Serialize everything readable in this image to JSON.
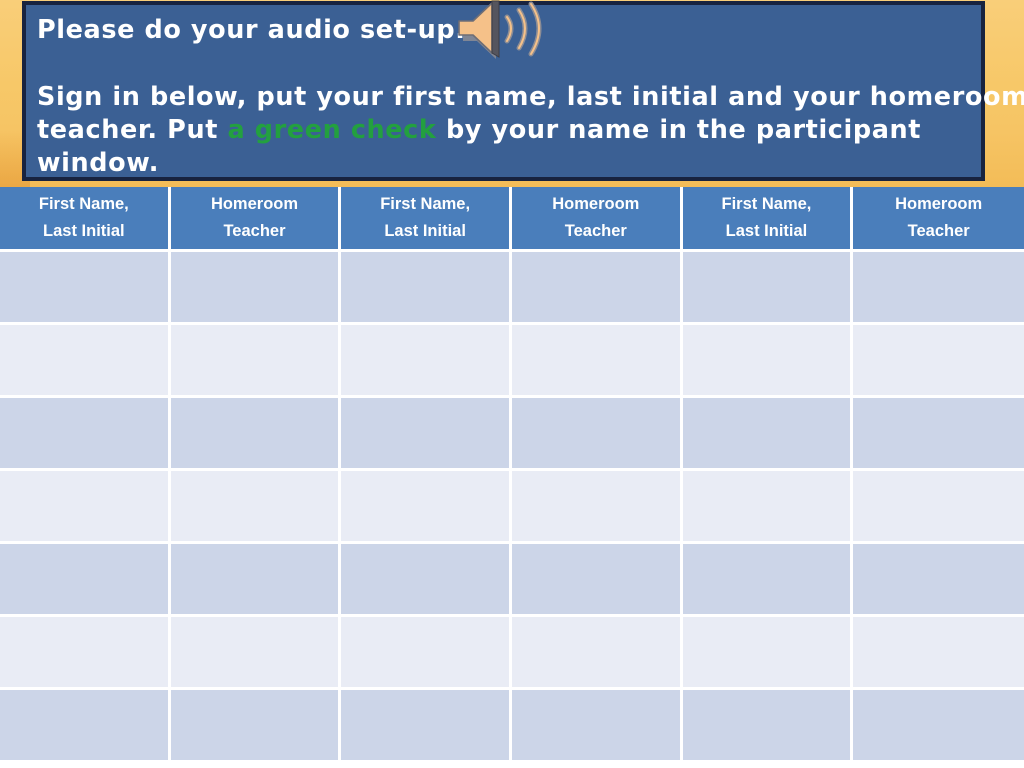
{
  "slide": {
    "accent_orange": "#f7c868",
    "callout_bg": "#3b6094",
    "callout_border": "#18233f",
    "header_bg": "#4a7ebb",
    "row_dark": "#ccd5e8",
    "row_light": "#e9ecf5",
    "green_accent": "#23a03f"
  },
  "callout": {
    "line1": "Please do your audio set-up.",
    "line2": "Sign in below, put your first name, last initial and your homeroom",
    "line3_pre": "teacher. Put ",
    "line3_green": "a green check",
    "line3_post": " by your name in the participant",
    "line4": "window.",
    "speaker_icon": "speaker-sound-icon"
  },
  "table": {
    "headers": [
      "First Name,\nLast Initial",
      "Homeroom\nTeacher",
      "First Name,\nLast Initial",
      "Homeroom\nTeacher",
      "First Name,\nLast Initial",
      "Homeroom\nTeacher"
    ],
    "rows": [
      [
        "",
        "",
        "",
        "",
        "",
        ""
      ],
      [
        "",
        "",
        "",
        "",
        "",
        ""
      ],
      [
        "",
        "",
        "",
        "",
        "",
        ""
      ],
      [
        "",
        "",
        "",
        "",
        "",
        ""
      ],
      [
        "",
        "",
        "",
        "",
        "",
        ""
      ],
      [
        "",
        "",
        "",
        "",
        "",
        ""
      ],
      [
        "",
        "",
        "",
        "",
        "",
        ""
      ]
    ]
  }
}
